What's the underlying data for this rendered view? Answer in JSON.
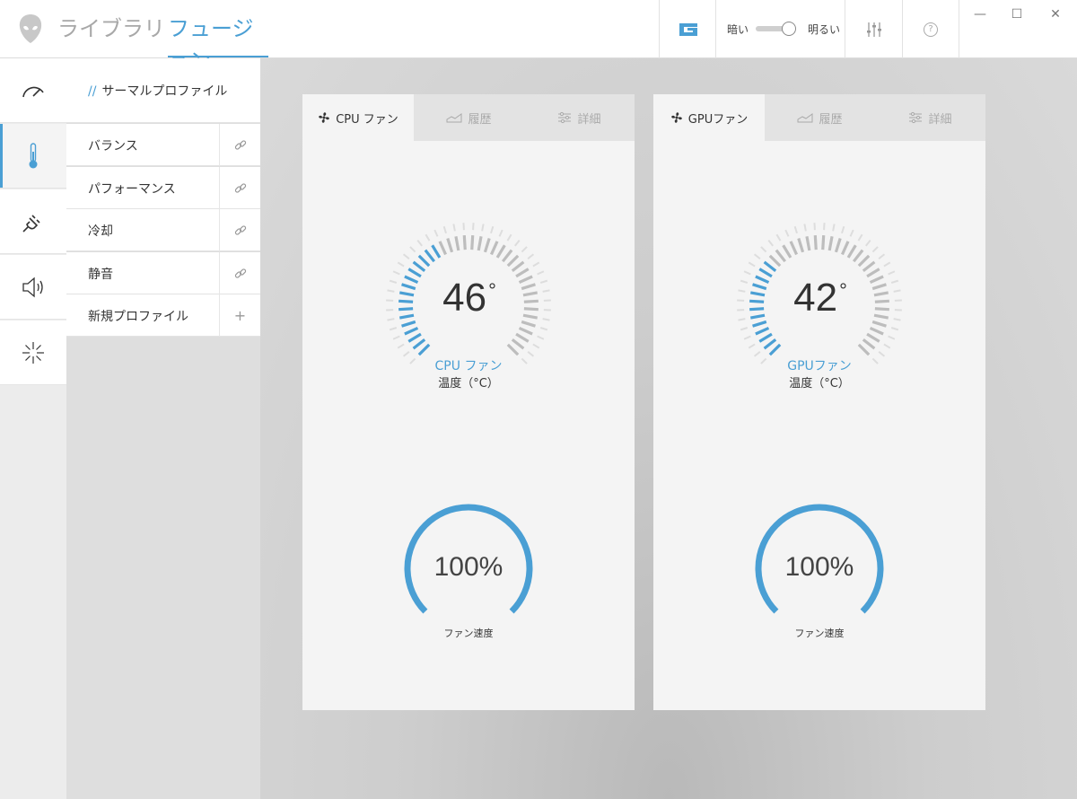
{
  "header": {
    "nav": {
      "library": "ライブラリ",
      "fusion": "フュージョン"
    },
    "theme": {
      "dark_label": "暗い",
      "light_label": "明るい",
      "mode": "light"
    },
    "help_symbol": "?",
    "window": {
      "minimize": "—",
      "maximize": "☐",
      "close": "✕"
    }
  },
  "rail": {
    "items": [
      {
        "icon": "speedometer-icon",
        "active": false
      },
      {
        "icon": "thermometer-icon",
        "active": true
      },
      {
        "icon": "power-plug-icon",
        "active": false
      },
      {
        "icon": "speaker-icon",
        "active": false
      },
      {
        "icon": "light-burst-icon",
        "active": false
      }
    ]
  },
  "profiles": {
    "title_prefix": "//",
    "title": "サーマルプロファイル",
    "items": [
      {
        "label": "バランス",
        "action_icon": "link-icon",
        "active": true
      },
      {
        "label": "パフォーマンス",
        "action_icon": "link-icon",
        "active": false
      },
      {
        "label": "冷却",
        "action_icon": "link-icon",
        "active": false
      },
      {
        "label": "静音",
        "action_icon": "link-icon",
        "active": false
      },
      {
        "label": "新規プロファイル",
        "action_icon": "plus-icon",
        "action_symbol": "+",
        "active": false
      }
    ]
  },
  "cards": {
    "cpu": {
      "tabs": [
        "CPU ファン",
        "履歴",
        "詳細"
      ],
      "temperature": "46",
      "fan_name": "CPU ファン",
      "temp_label": "温度（°C）",
      "temp_fill_fraction": 0.4,
      "speed": "100%",
      "speed_fraction": 1.0,
      "speed_label": "ファン速度"
    },
    "gpu": {
      "tabs": [
        "GPUファン",
        "履歴",
        "詳細"
      ],
      "temperature": "42",
      "fan_name": "GPUファン",
      "temp_label": "温度（°C）",
      "temp_fill_fraction": 0.33,
      "speed": "100%",
      "speed_fraction": 1.0,
      "speed_label": "ファン速度"
    }
  },
  "colors": {
    "accent": "#4a9fd4",
    "tick_inactive": "#bdbdbd",
    "tick_outer": "#dddddd"
  }
}
